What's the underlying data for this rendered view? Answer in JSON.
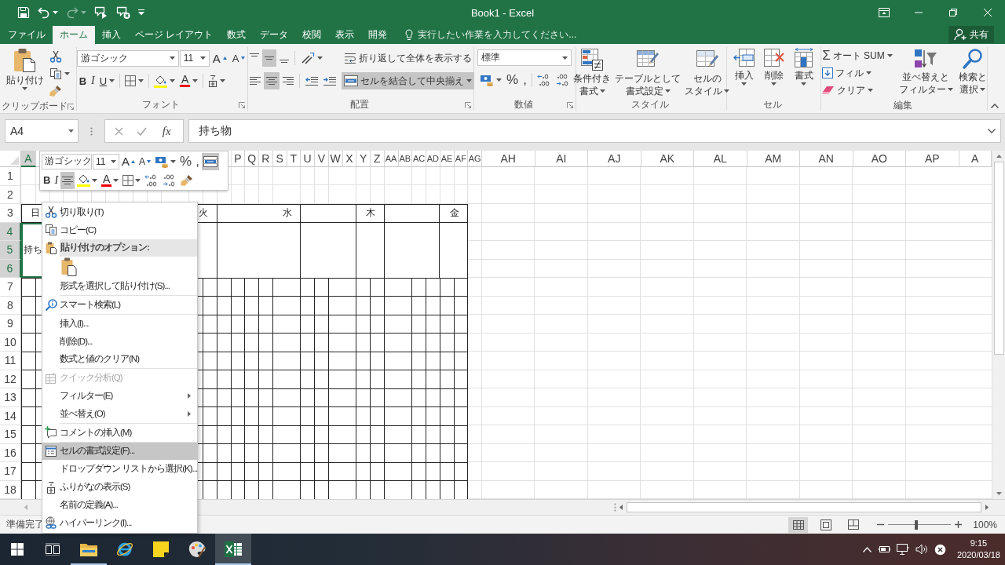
{
  "window": {
    "title": "Book1 - Excel"
  },
  "quick_access": [
    {
      "kind": "save",
      "disabled": false
    },
    {
      "kind": "undo",
      "disabled": false
    },
    {
      "kind": "redo",
      "disabled": true
    },
    {
      "kind": "bubble_play",
      "disabled": false
    },
    {
      "kind": "bubble_close",
      "disabled": false
    },
    {
      "kind": "customize",
      "disabled": false
    }
  ],
  "tabs": [
    {
      "label": "ファイル",
      "selected": false
    },
    {
      "label": "ホーム",
      "selected": true
    },
    {
      "label": "挿入",
      "selected": false
    },
    {
      "label": "ページ レイアウト",
      "selected": false
    },
    {
      "label": "数式",
      "selected": false
    },
    {
      "label": "データ",
      "selected": false
    },
    {
      "label": "校閲",
      "selected": false
    },
    {
      "label": "表示",
      "selected": false
    },
    {
      "label": "開発",
      "selected": false
    }
  ],
  "tell_me": {
    "label": "実行したい作業を入力してください..."
  },
  "share": {
    "label": "共有"
  },
  "ribbon": {
    "clipboard": {
      "label": "クリップボード",
      "paste": "貼り付け"
    },
    "font": {
      "label": "フォント",
      "font_name": "游ゴシック",
      "font_size": "11",
      "grow": "A",
      "shrink": "A",
      "bold": "B",
      "italic": "I",
      "underline": "U",
      "font_color": "A"
    },
    "alignment": {
      "label": "配置",
      "vertical": [
        {
          "kind": "top",
          "selected": false
        },
        {
          "kind": "middle",
          "selected": true
        },
        {
          "kind": "bottom",
          "selected": false
        }
      ],
      "horizontal": [
        {
          "kind": "left",
          "selected": false
        },
        {
          "kind": "center",
          "selected": true
        },
        {
          "kind": "right",
          "selected": false
        }
      ],
      "wrap_text": {
        "label": "折り返して全体を表示する",
        "selected": false
      },
      "merge_center": {
        "label": "セルを結合して中央揃え",
        "selected": true
      }
    },
    "number": {
      "label": "数値",
      "format": "標準",
      "percent": "%",
      "comma": ","
    },
    "styles": {
      "label": "スタイル",
      "buttons": [
        {
          "kind": "conditional",
          "lines": [
            "条件付き",
            "書式"
          ]
        },
        {
          "kind": "table",
          "lines": [
            "テーブルとして",
            "書式設定"
          ]
        },
        {
          "kind": "cell_styles",
          "lines": [
            "セルの",
            "スタイル"
          ]
        }
      ]
    },
    "cells": {
      "label": "セル",
      "buttons": [
        {
          "kind": "insert",
          "label": "挿入"
        },
        {
          "kind": "delete",
          "label": "削除"
        },
        {
          "kind": "format",
          "label": "書式"
        }
      ]
    },
    "editing": {
      "label": "編集",
      "autosum": {
        "symbol": "Σ",
        "label": "オート SUM"
      },
      "fill": "フィル",
      "clear": "クリア",
      "sort_filter": [
        "並べ替えと",
        "フィルター"
      ],
      "find_select": [
        "検索と",
        "選択"
      ]
    }
  },
  "formula_bar": {
    "name_box": "A4",
    "function_symbol": "fx",
    "formula": "持ち物"
  },
  "sheet": {
    "columns": [
      {
        "label": "A",
        "selected": true
      },
      {
        "label": "P",
        "selected": false
      },
      {
        "label": "Q",
        "selected": false
      },
      {
        "label": "R",
        "selected": false
      },
      {
        "label": "S",
        "selected": false
      },
      {
        "label": "T",
        "selected": false
      },
      {
        "label": "U",
        "selected": false
      },
      {
        "label": "V",
        "selected": false
      },
      {
        "label": "W",
        "selected": false
      },
      {
        "label": "X",
        "selected": false
      },
      {
        "label": "Y",
        "selected": false
      },
      {
        "label": "Z",
        "selected": false
      },
      {
        "label": "AA",
        "selected": false
      },
      {
        "label": "AB",
        "selected": false
      },
      {
        "label": "AC",
        "selected": false
      },
      {
        "label": "AD",
        "selected": false
      },
      {
        "label": "AE",
        "selected": false
      },
      {
        "label": "AF",
        "selected": false
      },
      {
        "label": "AG",
        "selected": false
      },
      {
        "label": "AH",
        "selected": false
      },
      {
        "label": "AI",
        "selected": false
      },
      {
        "label": "AJ",
        "selected": false
      },
      {
        "label": "AK",
        "selected": false
      },
      {
        "label": "AL",
        "selected": false
      },
      {
        "label": "AM",
        "selected": false
      },
      {
        "label": "AN",
        "selected": false
      },
      {
        "label": "AO",
        "selected": false
      },
      {
        "label": "AP",
        "selected": false
      },
      {
        "label": "A",
        "selected": false
      }
    ],
    "rows": [
      {
        "label": "1",
        "selected": false
      },
      {
        "label": "2",
        "selected": false
      },
      {
        "label": "3",
        "selected": false
      },
      {
        "label": "4",
        "selected": true
      },
      {
        "label": "5",
        "selected": true
      },
      {
        "label": "6",
        "selected": true
      },
      {
        "label": "7",
        "selected": false
      },
      {
        "label": "8",
        "selected": false
      },
      {
        "label": "9",
        "selected": false
      },
      {
        "label": "10",
        "selected": false
      },
      {
        "label": "11",
        "selected": false
      },
      {
        "label": "12",
        "selected": false
      },
      {
        "label": "13",
        "selected": false
      },
      {
        "label": "14",
        "selected": false
      },
      {
        "label": "15",
        "selected": false
      },
      {
        "label": "16",
        "selected": false
      },
      {
        "label": "17",
        "selected": false
      },
      {
        "label": "18",
        "selected": false
      }
    ],
    "table": {
      "day_labels": [
        "日",
        "火",
        "水",
        "木",
        "金"
      ],
      "item": {
        "text": "持ち",
        "selected": true
      }
    }
  },
  "mini_toolbar": {
    "font_name": "游ゴシック",
    "font_size": "11",
    "grow": "A",
    "shrink": "A",
    "percent": "%",
    "comma": ",",
    "merge_center": {
      "selected": true
    },
    "bold": "B",
    "italic": "I",
    "align_center": {
      "selected": true
    },
    "font_color": "A"
  },
  "context_menu": {
    "sections": [
      [
        {
          "kind": "cut",
          "label": "切り取り(T)",
          "disabled": false,
          "highlighted": false
        },
        {
          "kind": "copy",
          "label": "コピー(C)",
          "disabled": false,
          "highlighted": false
        },
        {
          "kind": "paste_header",
          "label": "貼り付けのオプション:",
          "disabled": false,
          "highlighted": false
        },
        {
          "kind": "paste_icon",
          "disabled": false,
          "highlighted": false
        },
        {
          "kind": "plain",
          "label": "形式を選択して貼り付け(S)...",
          "disabled": false,
          "highlighted": false
        }
      ],
      [
        {
          "kind": "lookup",
          "label": "スマート検索(L)",
          "disabled": false,
          "highlighted": false
        }
      ],
      [
        {
          "kind": "plain",
          "label": "挿入(I)...",
          "disabled": false,
          "highlighted": false
        },
        {
          "kind": "plain",
          "label": "削除(D)...",
          "disabled": false,
          "highlighted": false
        },
        {
          "kind": "plain",
          "label": "数式と値のクリア(N)",
          "disabled": false,
          "highlighted": false
        }
      ],
      [
        {
          "kind": "analysis",
          "label": "クイック分析(Q)",
          "disabled": true,
          "highlighted": false
        },
        {
          "kind": "submenu",
          "label": "フィルター(E)",
          "disabled": false,
          "highlighted": false
        },
        {
          "kind": "submenu",
          "label": "並べ替え(O)",
          "disabled": false,
          "highlighted": false
        }
      ],
      [
        {
          "kind": "comment",
          "label": "コメントの挿入(M)",
          "disabled": false,
          "highlighted": false
        }
      ],
      [
        {
          "kind": "format",
          "label": "セルの書式設定(F)...",
          "disabled": false,
          "highlighted": true
        },
        {
          "kind": "plain",
          "label": "ドロップダウン リストから選択(K)...",
          "disabled": false,
          "highlighted": false
        },
        {
          "kind": "furigana",
          "label": "ふりがなの表示(S)",
          "disabled": false,
          "highlighted": false
        },
        {
          "kind": "plain",
          "label": "名前の定義(A)...",
          "disabled": false,
          "highlighted": false
        },
        {
          "kind": "link",
          "label": "ハイパーリンク(I)...",
          "disabled": false,
          "highlighted": false
        }
      ]
    ]
  },
  "status_bar": {
    "status": "準備完了",
    "views": [
      {
        "kind": "normal",
        "selected": true
      },
      {
        "kind": "page_layout",
        "selected": false
      },
      {
        "kind": "page_break",
        "selected": false
      }
    ],
    "zoom": {
      "level": 0.45,
      "reading": "100%"
    }
  },
  "taskbar": {
    "apps": [
      {
        "kind": "start",
        "running": false,
        "active": false
      },
      {
        "kind": "task_view",
        "running": false,
        "active": false
      },
      {
        "kind": "explorer",
        "running": true,
        "active": false
      },
      {
        "kind": "browser",
        "running": false,
        "active": false
      },
      {
        "kind": "sticky_notes",
        "running": false,
        "active": false
      },
      {
        "kind": "paint",
        "running": false,
        "active": false
      },
      {
        "kind": "excel",
        "running": true,
        "active": true
      }
    ],
    "clock": {
      "time": "9:15",
      "date": "2020/03/18"
    }
  }
}
